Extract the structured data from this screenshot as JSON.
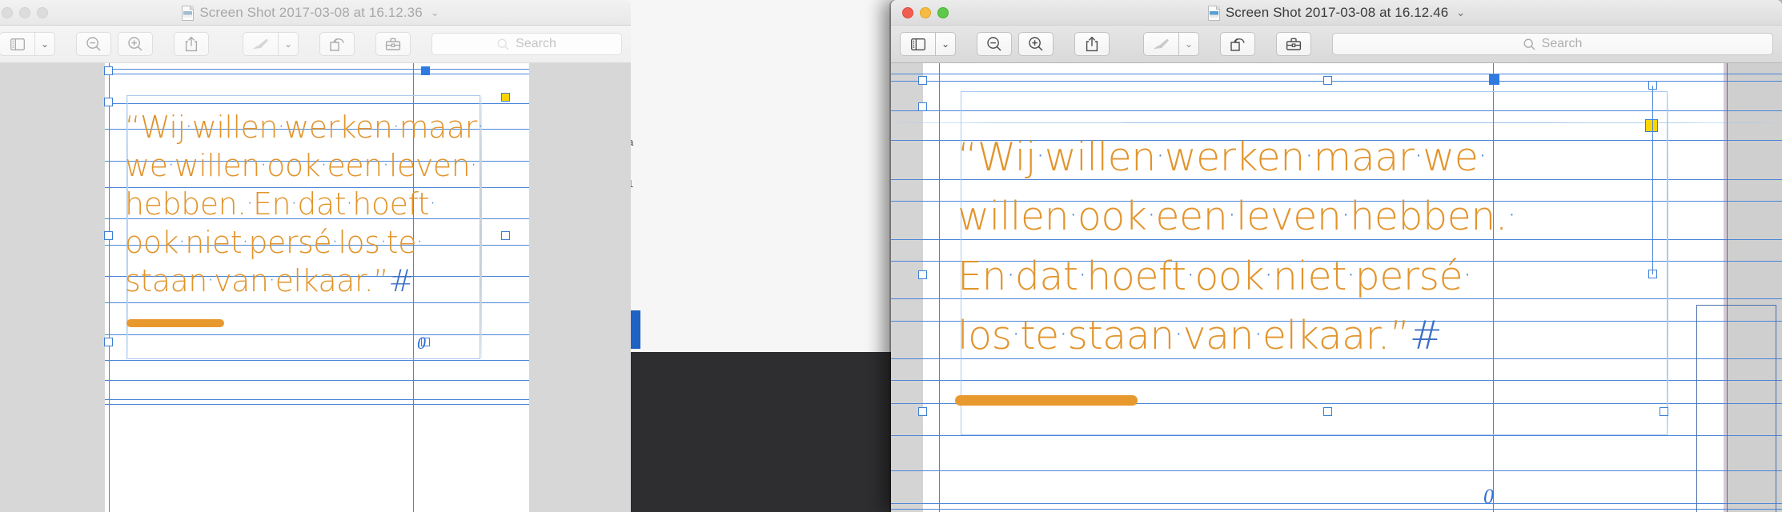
{
  "meta": {
    "accent_orange": "#e2942c",
    "guide_blue": "#4a86d8",
    "guide_magenta": "#9b3fcf",
    "handle_yellow": "#ffd500"
  },
  "background_app": {
    "visible_labels": [
      "a",
      "1"
    ]
  },
  "windows": [
    {
      "id": "left",
      "state": "inactive",
      "title": "Screen Shot 2017-03-08 at 16.12.36",
      "title_chevron": "⌄",
      "doc_icon": "preview-document-icon",
      "traffic_lights": [
        "close",
        "minimize",
        "zoom"
      ],
      "toolbar": {
        "sidebar_label": "sidebar-icon",
        "sidebar_chevron": "⌄",
        "zoom_out_label": "zoom-out-icon",
        "zoom_in_label": "zoom-in-icon",
        "share_label": "share-icon",
        "markup_label": "markup-pen-icon",
        "markup_chevron": "⌄",
        "rotate_label": "rotate-left-icon",
        "toolkit_label": "toolbox-icon",
        "search_placeholder": "Search",
        "search_value": ""
      },
      "document": {
        "lines": [
          "“Wij·willen·werken·maar·",
          "we·willen·ook·een·leven·",
          "hebben.·En·dat·hoeft·",
          "ook·niet·persé·los·te·",
          "staan·van·elkaar.”#"
        ],
        "paragraph_mark": "#",
        "page_number": "0",
        "orange_rule": "orange-highlight-bar"
      }
    },
    {
      "id": "right",
      "state": "active",
      "title": "Screen Shot 2017-03-08 at 16.12.46",
      "title_chevron": "⌄",
      "doc_icon": "preview-document-icon",
      "traffic_lights": [
        "close",
        "minimize",
        "zoom"
      ],
      "toolbar": {
        "sidebar_label": "sidebar-icon",
        "sidebar_chevron": "⌄",
        "zoom_out_label": "zoom-out-icon",
        "zoom_in_label": "zoom-in-icon",
        "share_label": "share-icon",
        "markup_label": "markup-pen-icon",
        "markup_chevron": "⌄",
        "rotate_label": "rotate-left-icon",
        "toolkit_label": "toolbox-icon",
        "search_placeholder": "Search",
        "search_value": ""
      },
      "document": {
        "lines": [
          "“Wij·willen·werken·maar·we·",
          "willen·ook·een·leven·hebben.·",
          "En·dat·hoeft·ook·niet·persé·",
          "los·te·staan·van·elkaar.”#"
        ],
        "paragraph_mark": "#",
        "page_number": "0",
        "orange_rule": "orange-highlight-bar"
      }
    }
  ]
}
